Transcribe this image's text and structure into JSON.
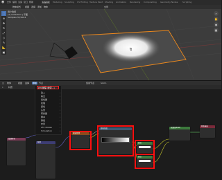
{
  "topbar": {
    "menus": [
      "文件",
      "编辑",
      "渲染",
      "窗口",
      "帮助"
    ],
    "workspaces": [
      "Layout",
      "Modeling",
      "Sculpting",
      "UV Editing",
      "Texture Paint",
      "Shading",
      "Animation",
      "Rendering",
      "Compositing",
      "Geometry Nodes",
      "Scripting"
    ],
    "active_workspace": "Layout"
  },
  "viewport": {
    "header": {
      "mode": "物体模式",
      "view": "视图",
      "select": "选择",
      "add": "添加",
      "object": "物体",
      "transform": "全局"
    },
    "info_lines": [
      "用户透视",
      "(1) Collection | 平面",
      "Samples 32/1024"
    ],
    "tools": [
      "select",
      "cursor",
      "move",
      "rotate",
      "scale",
      "transform",
      "annotate",
      "measure",
      "add-cube"
    ],
    "gizmos": [
      "zoom-icon",
      "hand-icon",
      "camera-icon",
      "grid-icon"
    ]
  },
  "node_editor": {
    "header": {
      "editor_type": "物体",
      "view": "视图",
      "select": "选择",
      "add": "添加",
      "node": "节点",
      "slot": "插槽",
      "material": "材质",
      "use_nodes": "使用节点",
      "slot_label": "Slot 1"
    },
    "add_menu": {
      "search_label": "LFC纹理 (搜索...)",
      "items": [
        "输入",
        "输出",
        "着色器",
        "纹理",
        "颜色",
        "矢量",
        "转换器",
        "脚本",
        "群组",
        "布局",
        "LFC Nodes",
        "Simulation"
      ]
    },
    "nodes": {
      "texcoord": {
        "title": "纹理坐标"
      },
      "mapping": {
        "title": "映射"
      },
      "noise": {
        "title": "噪波纹理"
      },
      "colorramp": {
        "title": "颜色渐变"
      },
      "mix1": {
        "title": "混合"
      },
      "mix2": {
        "title": "混合"
      },
      "bsdf": {
        "title": "原理化BSDF"
      },
      "output": {
        "title": "材质输出"
      }
    }
  }
}
